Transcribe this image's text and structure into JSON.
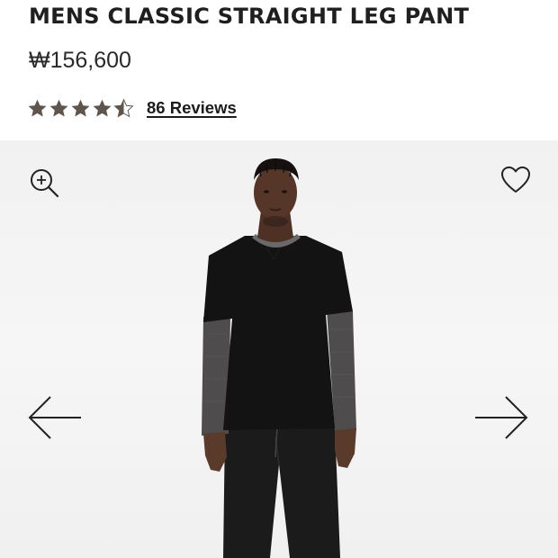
{
  "product": {
    "title": "MENS CLASSIC STRAIGHT LEG PANT",
    "price": "₩156,600",
    "rating": 4.5,
    "rating_max": 5,
    "reviews_label": "86 Reviews"
  },
  "colors": {
    "star": "#5e554c",
    "text": "#1c1c1c"
  },
  "gallery": {
    "image_alt": "Model wearing black tee over grey long sleeve and black straight leg pants",
    "icons": {
      "zoom": "zoom-in-icon",
      "favorite": "heart-icon",
      "previous": "arrow-left-icon",
      "next": "arrow-right-icon"
    }
  }
}
